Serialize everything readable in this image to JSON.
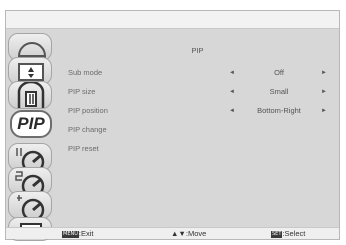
{
  "menu": {
    "title": "PIP",
    "sidebar": {
      "items": [
        {
          "icon": "picture-icon"
        },
        {
          "icon": "screen-icon"
        },
        {
          "icon": "audio-icon"
        },
        {
          "icon": "pip-icon",
          "label": "PIP",
          "active": true
        },
        {
          "icon": "configuration1-icon"
        },
        {
          "icon": "configuration2-icon"
        },
        {
          "icon": "advanced-option-icon"
        },
        {
          "icon": "input-icon"
        }
      ]
    },
    "rows": [
      {
        "label": "Sub mode",
        "value": "Off",
        "has_arrows": true
      },
      {
        "label": "PIP size",
        "value": "Small",
        "has_arrows": true
      },
      {
        "label": "PIP position",
        "value": "Bottom-Right",
        "has_arrows": true
      },
      {
        "label": "PIP change",
        "value": "",
        "has_arrows": false
      },
      {
        "label": "PIP reset",
        "value": "",
        "has_arrows": false
      }
    ],
    "arrows": {
      "left": "◄",
      "right": "►"
    },
    "footer": {
      "exit": {
        "key": "MENU",
        "text": ":Exit"
      },
      "move": {
        "key": "▲▼",
        "text": ":Move"
      },
      "select": {
        "key": "SET",
        "text": ":Select"
      }
    }
  },
  "colors": {
    "panel": "#d7d7d7",
    "active_border": "#6d6d6d",
    "text": "#555555"
  }
}
